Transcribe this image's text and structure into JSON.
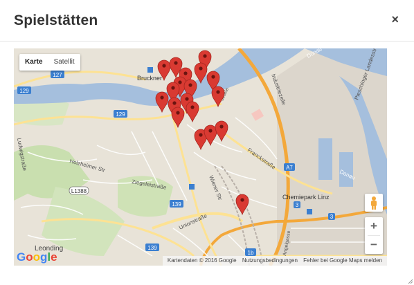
{
  "modal": {
    "title": "Spielstätten",
    "close_icon": "close-icon",
    "close_glyph": "×"
  },
  "map": {
    "type_control": {
      "map_label": "Karte",
      "satellite_label": "Satellit"
    },
    "labels": {
      "bruckner": "Bruckner",
      "industriezeile": "Industriezeile",
      "franckstrasse": "Franckstraße",
      "holzheimer": "Holzheimer Str",
      "ludwigstrasse": "Ludwigstraße",
      "ziegeleistrasse": "Ziegeleistraße",
      "wiener": "Wiener Str",
      "unionstrasse": "Unionstraße",
      "chemiepark": "Chemiepark Linz",
      "leonding": "Leonding",
      "donau1": "Donau",
      "donau2": "Donau",
      "pleschinger": "Pleschinger Landesstraße",
      "angelgasse": "Angelgasse",
      "strasse": "straße",
      "l1388": "L1388",
      "r127": "127",
      "r129a": "129",
      "r129b": "129",
      "r139a": "139",
      "r139b": "139",
      "r1b": "1b",
      "a7": "A7",
      "x3a": "3",
      "x3b": "3"
    },
    "zoom": {
      "in": "+",
      "out": "−"
    },
    "attribution": {
      "data": "Kartendaten © 2016 Google",
      "terms": "Nutzungsbedingungen",
      "report": "Fehler bei Google Maps melden"
    },
    "logo": {
      "g1": "G",
      "o1": "o",
      "o2": "o",
      "g2": "g",
      "l": "l",
      "e": "e"
    },
    "colors": {
      "water": "#a5bfdd",
      "land": "#e8e3d8",
      "park": "#c9dfaf",
      "highway": "#f3a83b",
      "major_road": "#fde293",
      "marker": "#d93a32"
    }
  }
}
